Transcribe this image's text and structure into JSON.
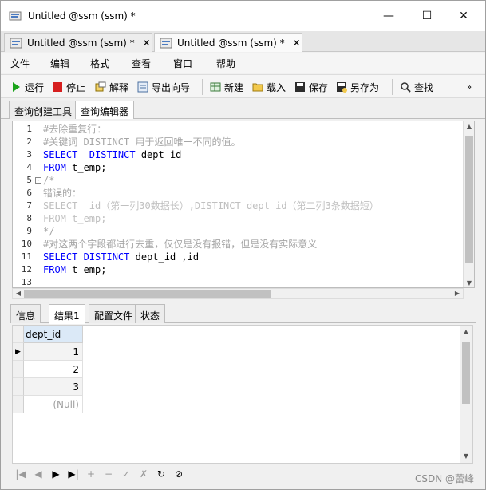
{
  "window": {
    "title": "Untitled @ssm (ssm) *",
    "controls": {
      "minimize": "—",
      "maximize": "☐",
      "close": "✕"
    }
  },
  "doc_tabs": [
    {
      "label": "Untitled @ssm (ssm) *",
      "close": "✕"
    },
    {
      "label": "Untitled @ssm (ssm) *",
      "close": "✕"
    }
  ],
  "menu": [
    "文件",
    "编辑",
    "格式",
    "查看",
    "窗口",
    "帮助"
  ],
  "toolbar": {
    "run": "运行",
    "stop": "停止",
    "explain": "解释",
    "export": "导出向导",
    "new": "新建",
    "load": "载入",
    "save": "保存",
    "save_as": "另存为",
    "find": "查找",
    "overflow": "»"
  },
  "sub_tabs": [
    "查询创建工具",
    "查询编辑器"
  ],
  "editor": {
    "lines": [
      {
        "n": "1",
        "parts": [
          [
            "c",
            "#去除重复行："
          ]
        ]
      },
      {
        "n": "2",
        "parts": [
          [
            "c",
            "#关键词 DISTINCT 用于返回唯一不同的值。"
          ]
        ]
      },
      {
        "n": "3",
        "parts": [
          [
            "k",
            "SELECT  DISTINCT"
          ],
          [
            "t",
            " dept_id"
          ]
        ]
      },
      {
        "n": "4",
        "parts": [
          [
            "k",
            "FROM"
          ],
          [
            "t",
            " t_emp;"
          ]
        ]
      },
      {
        "n": "5",
        "parts": [
          [
            "c",
            "/*"
          ]
        ],
        "fold": "-"
      },
      {
        "n": "6",
        "parts": [
          [
            "c",
            "错误的："
          ]
        ]
      },
      {
        "n": "7",
        "parts": [
          [
            "d",
            "SELECT  id（第一列30数据长）,DISTINCT dept_id（第二列3条数据短）"
          ]
        ]
      },
      {
        "n": "8",
        "parts": [
          [
            "d",
            "FROM t_emp;"
          ]
        ]
      },
      {
        "n": "9",
        "parts": [
          [
            "c",
            "*/"
          ]
        ]
      },
      {
        "n": "10",
        "parts": [
          [
            "c",
            "#对这两个字段都进行去重，仅仅是没有报错，但是没有实际意义"
          ]
        ]
      },
      {
        "n": "11",
        "parts": [
          [
            "k",
            "SELECT DISTINCT"
          ],
          [
            "t",
            " dept_id ,id"
          ]
        ]
      },
      {
        "n": "12",
        "parts": [
          [
            "k",
            "FROM"
          ],
          [
            "t",
            " t_emp;"
          ]
        ]
      },
      {
        "n": "13",
        "parts": [
          [
            "t",
            ""
          ]
        ]
      }
    ]
  },
  "result_tabs": [
    "信息",
    "结果1",
    "配置文件",
    "状态"
  ],
  "grid": {
    "column": "dept_id",
    "rows": [
      "1",
      "2",
      "3",
      "(Null)"
    ],
    "current_row_marker": "▶"
  },
  "navbar": [
    "|◀",
    "◀",
    "▶",
    "▶|",
    "+",
    "−",
    "✓",
    "✗",
    "↻",
    "⊘"
  ],
  "watermark": "CSDN @蕾峰",
  "colors": {
    "keyword": "#0000ff",
    "comment": "#a6a6a6",
    "header_bg": "#dbe9f7"
  }
}
